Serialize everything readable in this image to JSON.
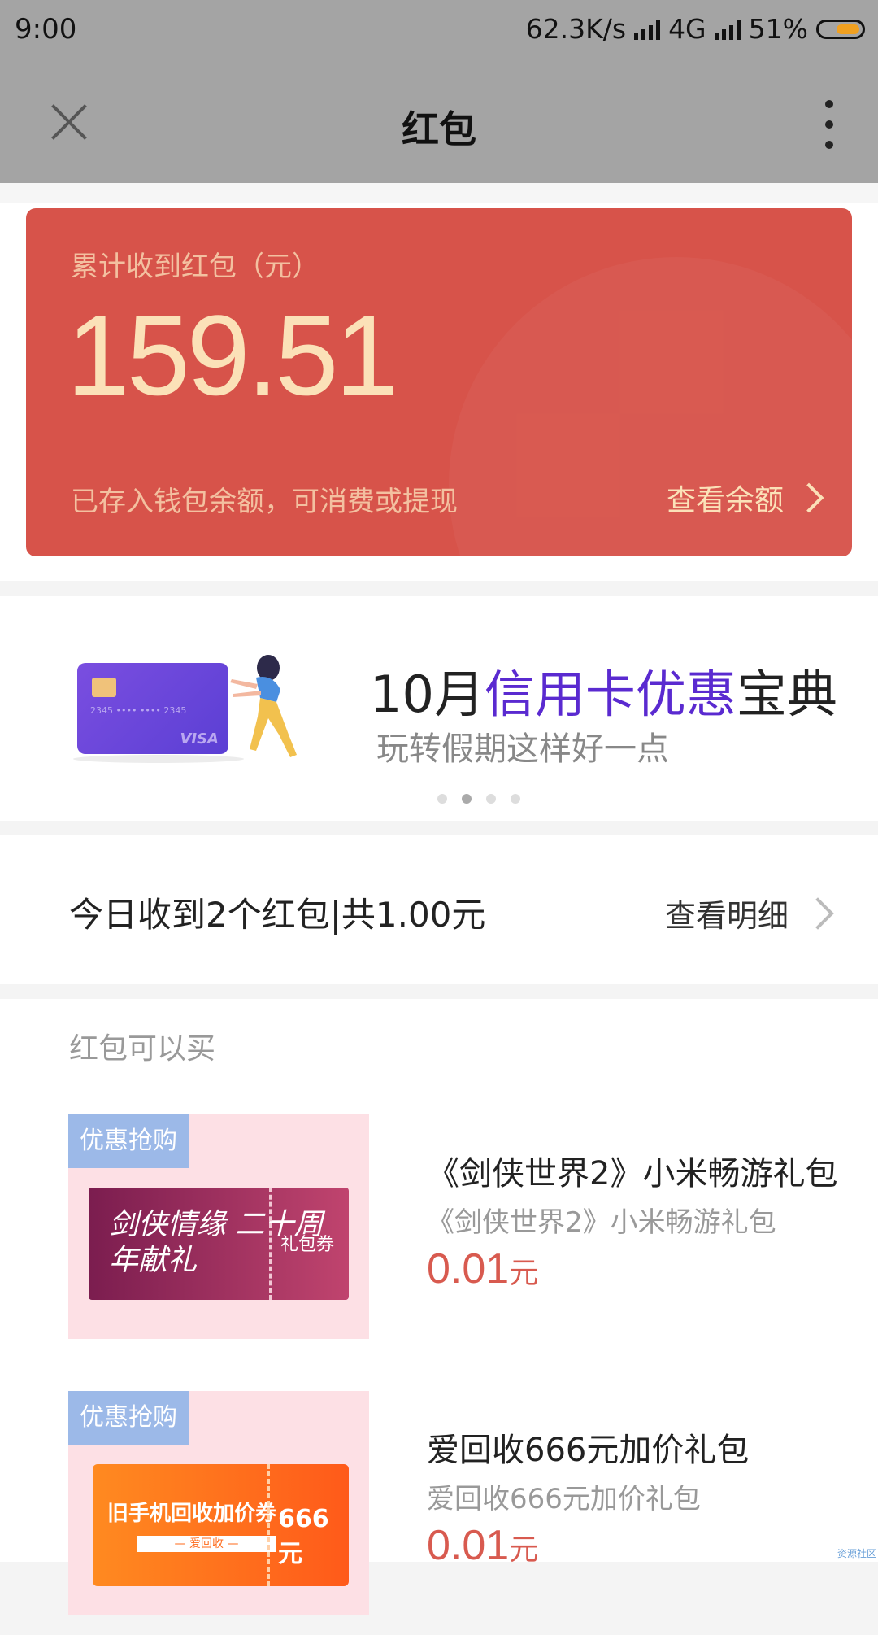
{
  "status_bar": {
    "time": "9:00",
    "net_speed": "62.3K/s",
    "network": "4G",
    "battery": "51%",
    "battery_level": 0.51
  },
  "header": {
    "title": "红包",
    "close_icon": "close-icon",
    "more_icon": "more-vertical-icon"
  },
  "summary_card": {
    "label": "累计收到红包（元）",
    "amount": "159.51",
    "note": "已存入钱包余额，可消费或提现",
    "link": "查看余额"
  },
  "banner": {
    "title_prefix": "10月",
    "title_highlight": "信用卡优惠",
    "title_suffix": "宝典",
    "subtitle": "玩转假期这样好一点",
    "card_number": "2345  ••••  ••••  2345",
    "card_brand": "VISA",
    "page_count": 4,
    "active_page": 2,
    "highlight_color": "#5a2ad0"
  },
  "today": {
    "text": "今日收到2个红包|共1.00元",
    "link": "查看明细"
  },
  "buy_section": {
    "title": "红包可以买",
    "products": [
      {
        "tag": "优惠抢购",
        "coupon_script": "剑侠情缘 二十周年献礼",
        "coupon_label": "礼包券",
        "name": "《剑侠世界2》小米畅游礼包",
        "subtitle": "《剑侠世界2》小米畅游礼包",
        "price": "0.01",
        "unit": "元"
      },
      {
        "tag": "优惠抢购",
        "coupon_script": "旧手机回收加价券",
        "coupon_sub": "— 爱回收 —",
        "coupon_value": "666元",
        "name": "爱回收666元加价礼包",
        "subtitle": "爱回收666元加价礼包",
        "price": "0.01",
        "unit": "元"
      }
    ]
  },
  "watermark": "资源社区",
  "colors": {
    "card_red": "#d7534a",
    "price_red": "#d85a4f",
    "tag_blue": "#9cb9e8",
    "header_gray": "#a4a4a4"
  }
}
